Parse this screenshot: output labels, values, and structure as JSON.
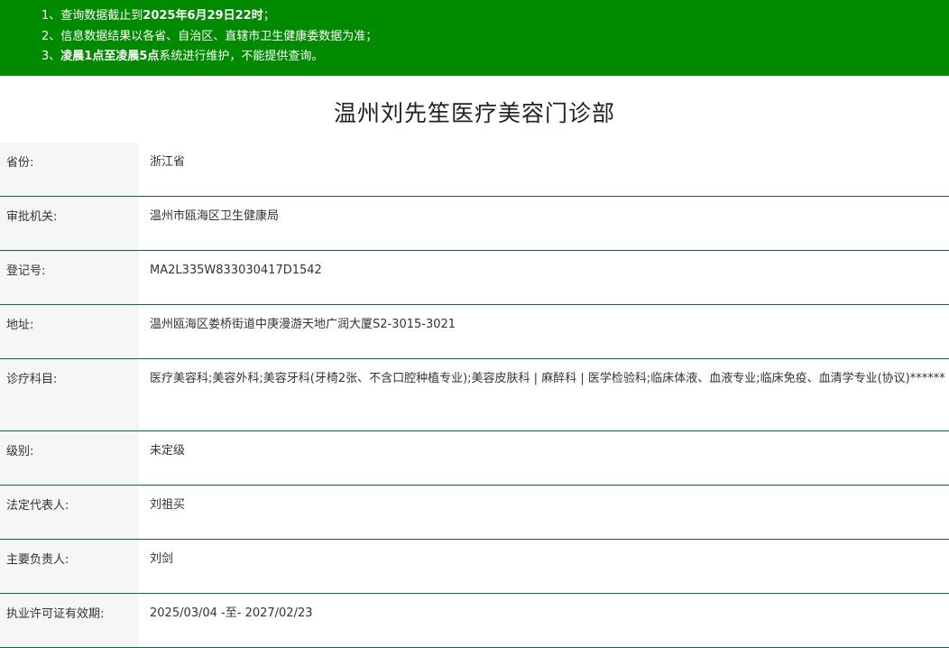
{
  "notices": [
    {
      "prefix": "1、查询数据截止到",
      "bold": "2025年6月29日22时",
      "suffix": "；"
    },
    {
      "prefix": "2、信息数据结果以各省、自治区、直辖市卫生健康委数据为准；",
      "bold": "",
      "suffix": ""
    },
    {
      "prefix": "3、",
      "bold": "凌晨1点至凌晨5点",
      "suffix": "系统进行维护，不能提供查询。"
    }
  ],
  "title": "温州刘先笙医疗美容门诊部",
  "rows": [
    {
      "label": "省份:",
      "value": "浙江省"
    },
    {
      "label": "审批机关:",
      "value": "温州市瓯海区卫生健康局"
    },
    {
      "label": "登记号:",
      "value": "MA2L335W833030417D1542"
    },
    {
      "label": "地址:",
      "value": "温州瓯海区娄桥街道中庚漫游天地广润大厦S2-3015-3021"
    },
    {
      "label": "诊疗科目:",
      "value": "医疗美容科;美容外科;美容牙科(牙椅2张、不含口腔种植专业);美容皮肤科 | 麻醉科 | 医学检验科;临床体液、血液专业;临床免疫、血清学专业(协议)******"
    },
    {
      "label": "级别:",
      "value": "未定级"
    },
    {
      "label": "法定代表人:",
      "value": "刘祖买"
    },
    {
      "label": "主要负责人:",
      "value": "刘剑"
    },
    {
      "label": "执业许可证有效期:",
      "value": "2025/03/04 -至- 2027/02/23"
    }
  ],
  "colors": {
    "notice_bg": "#008a00",
    "border": "#0c6b3a"
  }
}
